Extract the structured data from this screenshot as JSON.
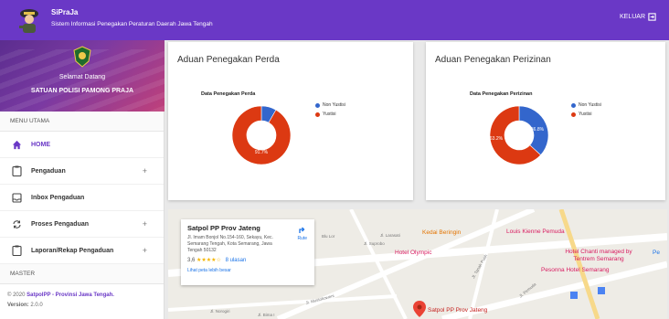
{
  "header": {
    "app_name": "SiPraJa",
    "app_subtitle": "Sistem Informasi Penegakan Peraturan Daerah Jawa Tengah",
    "logout_label": "KELUAR"
  },
  "sidebar": {
    "welcome": "Selamat Datang",
    "unit_name": "SATUAN POLISI PAMONG PRAJA",
    "section_main": "MENU UTAMA",
    "items": [
      {
        "label": "HOME",
        "icon": "home-icon",
        "active": true,
        "expand": ""
      },
      {
        "label": "Pengaduan",
        "icon": "clipboard-icon",
        "active": false,
        "expand": "+"
      },
      {
        "label": "Inbox Pengaduan",
        "icon": "inbox-icon",
        "active": false,
        "expand": ""
      },
      {
        "label": "Proses Pengaduan",
        "icon": "sync-icon",
        "active": false,
        "expand": "+"
      },
      {
        "label": "Laporan/Rekap Pengaduan",
        "icon": "clipboard-icon",
        "active": false,
        "expand": "+"
      }
    ],
    "section_master": "MASTER",
    "footer_prefix": "© 2020 ",
    "footer_brand": "SatpolPP - Provinsi Jawa Tengah.",
    "version_label": "Version:",
    "version_value": "2.0.0"
  },
  "cards": {
    "perda_title": "Aduan Penegakan Perda",
    "perizinan_title": "Aduan Penegakan Perizinan"
  },
  "colors": {
    "accent": "#6a38c6",
    "yustisi": "#dc3912",
    "non_yustisi": "#3366cc"
  },
  "chart_data": [
    {
      "type": "pie",
      "title": "Data Penegakan Perda",
      "donut": true,
      "legend": "right",
      "categories": [
        "Non Yustisi",
        "Yustisi"
      ],
      "values": [
        8.3,
        91.7
      ],
      "data_labels": [
        "",
        "91.7%"
      ]
    },
    {
      "type": "pie",
      "title": "Data Penegakan Perizinan",
      "donut": true,
      "legend": "right",
      "categories": [
        "Non Yustisi",
        "Yustisi"
      ],
      "values": [
        36.8,
        63.2
      ],
      "data_labels": [
        "36.8%",
        "63.2%"
      ]
    }
  ],
  "map": {
    "place_name": "Satpol PP Prov Jateng",
    "address": "Jl. Imam Bonjol No.154-160, Sekayu, Kec. Semarang Tengah, Kota Semarang, Jawa Tengah 50132",
    "rating": "3,6",
    "stars": "★★★★☆",
    "reviews": "8 ulasan",
    "bigger_map": "Lihat peta lebih besar",
    "directions": "Rute",
    "marker_label": "Satpol PP Prov Jateng",
    "labels": [
      "Kedai Beringin",
      "Louis Kienne Pemuda",
      "Hotel Olympic",
      "Hotel Chanti managed by Tentrem Semarang",
      "Pesonna Hotel Semarang",
      "Pe"
    ],
    "roads": [
      "Jl. Larasati",
      "Jl. Suprobo",
      "Jl. Tanah Putih",
      "Jl. Pemuda",
      "Jl. Mustokoweni",
      "Jl. Norogiri",
      "Jl. Bima I",
      "Blu Lor"
    ]
  }
}
